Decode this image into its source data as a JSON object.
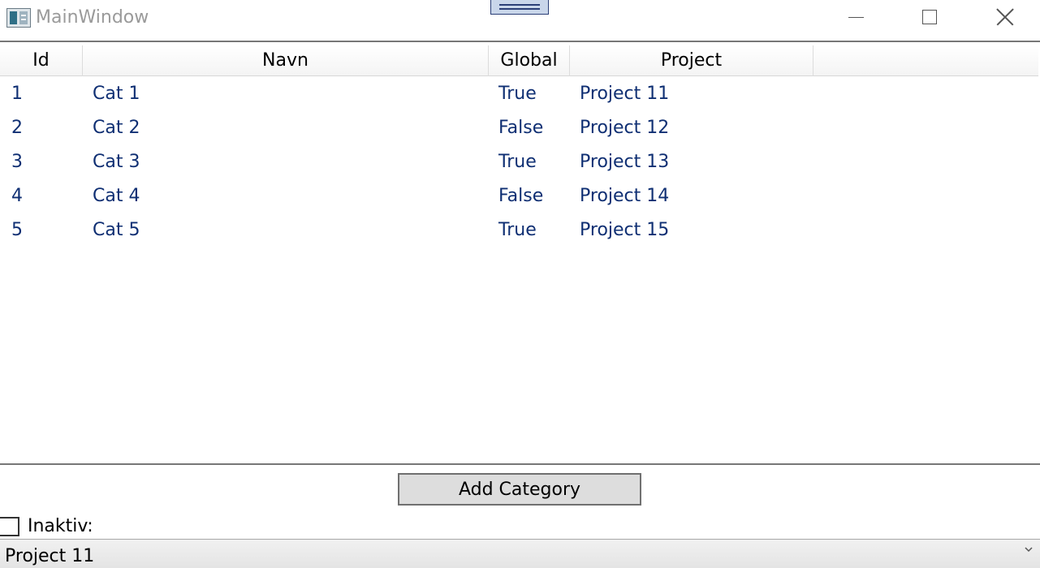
{
  "window": {
    "title": "MainWindow"
  },
  "grid": {
    "columns": [
      "Id",
      "Navn",
      "Global",
      "Project"
    ],
    "rows": [
      {
        "id": "1",
        "navn": "Cat 1",
        "global": "True",
        "project": "Project 11"
      },
      {
        "id": "2",
        "navn": "Cat 2",
        "global": "False",
        "project": "Project 12"
      },
      {
        "id": "3",
        "navn": "Cat 3",
        "global": "True",
        "project": "Project 13"
      },
      {
        "id": "4",
        "navn": "Cat 4",
        "global": "False",
        "project": "Project 14"
      },
      {
        "id": "5",
        "navn": "Cat 5",
        "global": "True",
        "project": "Project 15"
      }
    ]
  },
  "actions": {
    "add_category_label": "Add Category"
  },
  "filter": {
    "inaktiv_label": "Inaktiv:",
    "inaktiv_checked": false
  },
  "project_combo": {
    "selected": "Project 11"
  },
  "colors": {
    "cell_text": "#0f2f73",
    "separator": "#777777",
    "button_bg": "#dddddd"
  }
}
